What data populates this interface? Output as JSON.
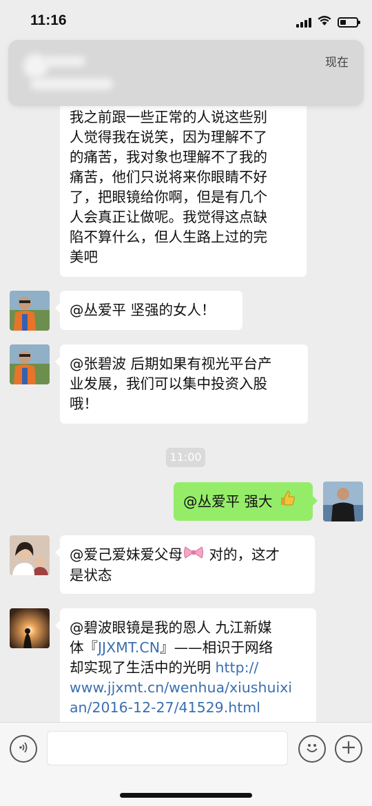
{
  "status_bar": {
    "time": "11:16"
  },
  "notification": {
    "time": "现在"
  },
  "messages": [
    {
      "side": "left",
      "lines": [
        "我之前跟一些正常的人说这些别",
        "人觉得我在说笑，因为理解不了",
        "的痛苦，我对象也理解不了我的",
        "痛苦，他们只说将来你眼睛不好",
        "了，把眼镜给你啊，但是有几个",
        "人会真正让做呢。我觉得这点缺",
        "陷不算什么，但人生路上过的完",
        "美吧"
      ]
    },
    {
      "side": "left",
      "text": "@丛爱平 坚强的女人！"
    },
    {
      "side": "left",
      "lines": [
        "@张碧波 后期如果有视光平台产",
        "业发展，我们可以集中投资入股",
        "哦！"
      ]
    },
    {
      "side": "right",
      "text": "@丛爱平 强大"
    },
    {
      "side": "left",
      "line1": "@爱己爱妹爱父母",
      "line1_after": " 对的，这才",
      "line2": "是状态"
    },
    {
      "side": "left",
      "l1": "@碧波眼镜是我的恩人 九江新媒",
      "l2_pre": "体『",
      "l2_link": "JJXMT.CN",
      "l2_post": "』——相识于网络",
      "l3_pre": " 却实现了生活中的光明 ",
      "l3_link": "http://",
      "l4": "www.jjxmt.cn/wenhua/xiushuixi",
      "l5": "an/2016-12-27/41529.html"
    }
  ],
  "timestamp": "11:00",
  "icons": [
    "voice-icon",
    "emoji-icon",
    "plus-icon",
    "wifi-icon",
    "signal-icon",
    "battery-icon",
    "thumbs-up-icon",
    "bow-icon"
  ],
  "colors": {
    "background": "#ededed",
    "bubble_left": "#ffffff",
    "bubble_right": "#95ec69",
    "link": "#3a6fb0"
  }
}
